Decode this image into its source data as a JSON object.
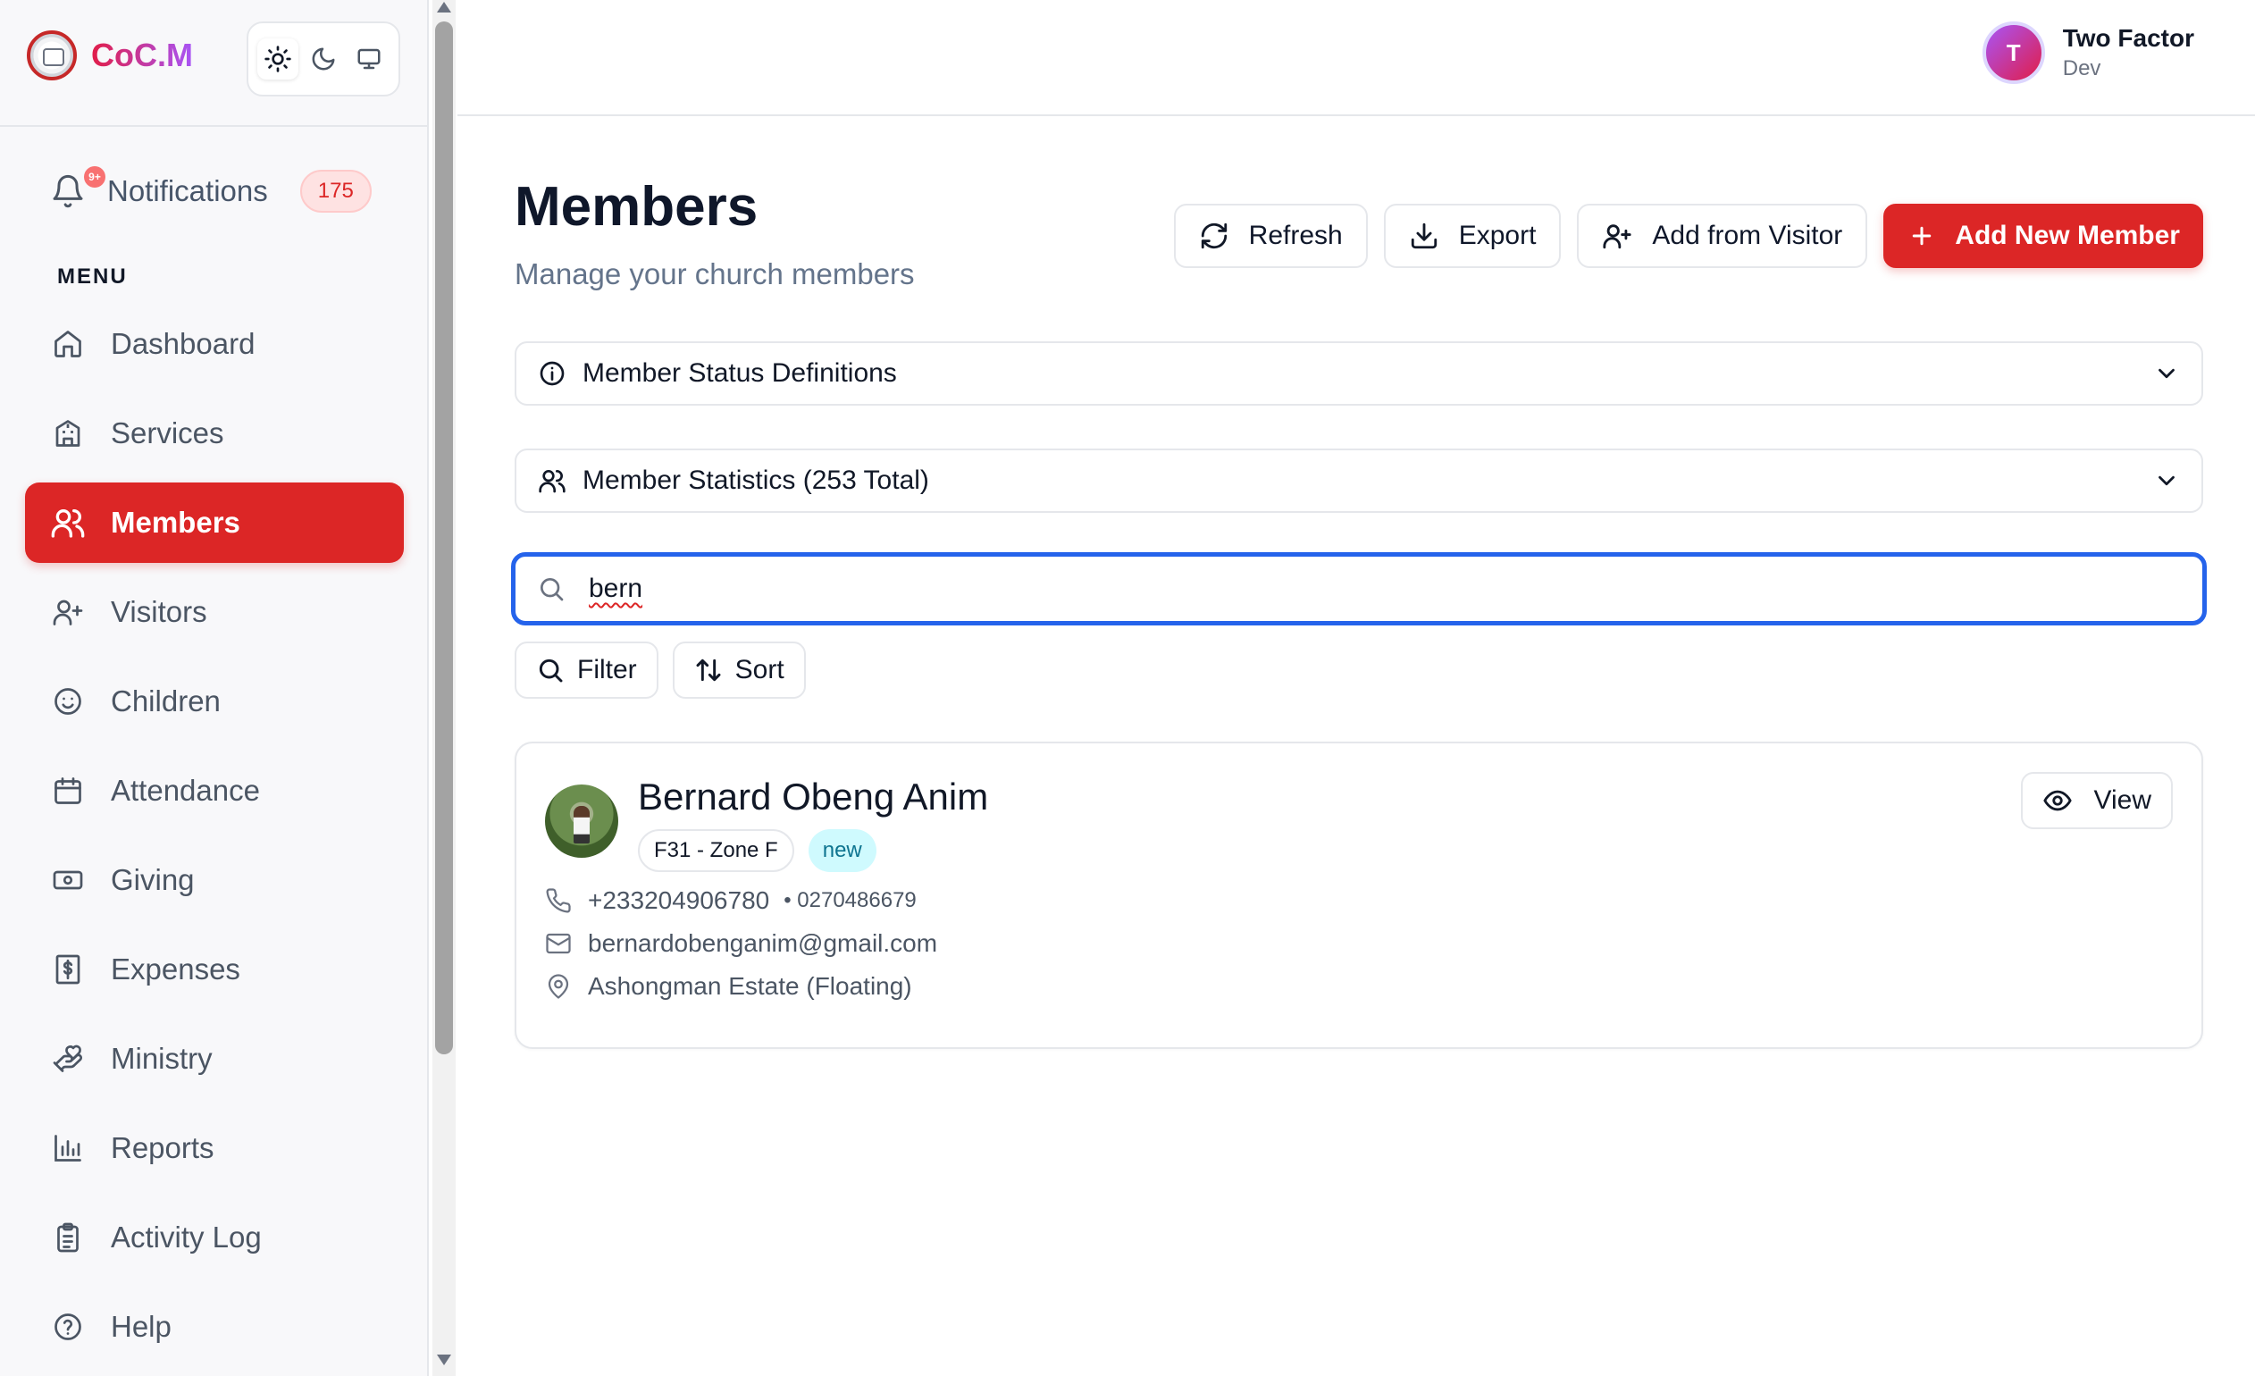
{
  "app": {
    "name": "CoC.M"
  },
  "theme": {
    "options": [
      "light",
      "dark",
      "system"
    ],
    "selected": "light"
  },
  "notifications": {
    "label": "Notifications",
    "count": "175",
    "dot": "9+"
  },
  "menu_heading": "MENU",
  "sidebar": {
    "items": [
      {
        "label": "Dashboard",
        "icon": "home-icon",
        "active": false
      },
      {
        "label": "Services",
        "icon": "building-icon",
        "active": false
      },
      {
        "label": "Members",
        "icon": "users-icon",
        "active": true
      },
      {
        "label": "Visitors",
        "icon": "user-plus-icon",
        "active": false
      },
      {
        "label": "Children",
        "icon": "smile-icon",
        "active": false
      },
      {
        "label": "Attendance",
        "icon": "calendar-icon",
        "active": false
      },
      {
        "label": "Giving",
        "icon": "banknote-icon",
        "active": false
      },
      {
        "label": "Expenses",
        "icon": "receipt-icon",
        "active": false
      },
      {
        "label": "Ministry",
        "icon": "hand-heart-icon",
        "active": false
      },
      {
        "label": "Reports",
        "icon": "bar-chart-icon",
        "active": false
      },
      {
        "label": "Activity Log",
        "icon": "clipboard-icon",
        "active": false
      },
      {
        "label": "Help",
        "icon": "help-circle-icon",
        "active": false
      }
    ]
  },
  "user": {
    "initial": "T",
    "name": "Two Factor",
    "role": "Dev"
  },
  "page": {
    "title": "Members",
    "subtitle": "Manage your church members"
  },
  "actions": {
    "refresh": "Refresh",
    "export": "Export",
    "add_from_visitor": "Add from Visitor",
    "add_new": "Add New Member"
  },
  "accordions": {
    "status_definitions": "Member Status Definitions",
    "statistics": "Member Statistics (253 Total)"
  },
  "search": {
    "value": "bern"
  },
  "filter_label": "Filter",
  "sort_label": "Sort",
  "member": {
    "name": "Bernard Obeng Anim",
    "zone": "F31 - Zone F",
    "status": "new",
    "phone": "+233204906780",
    "alt_phone": "• 0270486679",
    "email": "bernardobenganim@gmail.com",
    "address": "Ashongman Estate (Floating)",
    "view_label": "View"
  },
  "colors": {
    "accent": "#dc2626",
    "focus": "#2563eb",
    "badge_new": "#cffafe"
  }
}
